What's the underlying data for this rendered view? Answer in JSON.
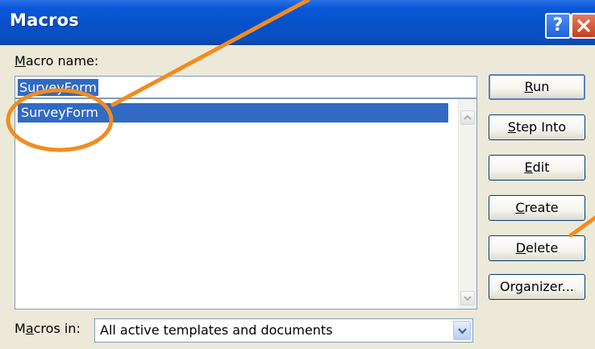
{
  "window": {
    "title": "Macros",
    "help_glyph": "?"
  },
  "macro_name": {
    "label_prefix": "",
    "label_accel": "M",
    "label_rest": "acro name:",
    "value": "SurveyForm"
  },
  "macro_list": {
    "items": [
      "SurveyForm"
    ],
    "selected": "SurveyForm"
  },
  "buttons": [
    {
      "pre": "",
      "acc": "R",
      "post": "un"
    },
    {
      "pre": "",
      "acc": "S",
      "post": "tep Into"
    },
    {
      "pre": "",
      "acc": "E",
      "post": "dit"
    },
    {
      "pre": "",
      "acc": "C",
      "post": "reate"
    },
    {
      "pre": "",
      "acc": "D",
      "post": "elete"
    },
    {
      "pre": "Or",
      "acc": "g",
      "post": "anizer..."
    }
  ],
  "macros_in": {
    "label_pre": "M",
    "label_acc": "a",
    "label_post": "cros in:",
    "value": "All active templates and documents"
  },
  "colors": {
    "title_bar": "#0a57d8",
    "selection": "#316ac5",
    "annotation": "#f28c1e",
    "dialog_bg": "#ece9d8"
  },
  "icons": [
    "help-icon",
    "close-icon",
    "scroll-up-icon",
    "scroll-down-icon",
    "dropdown-arrow-icon"
  ]
}
